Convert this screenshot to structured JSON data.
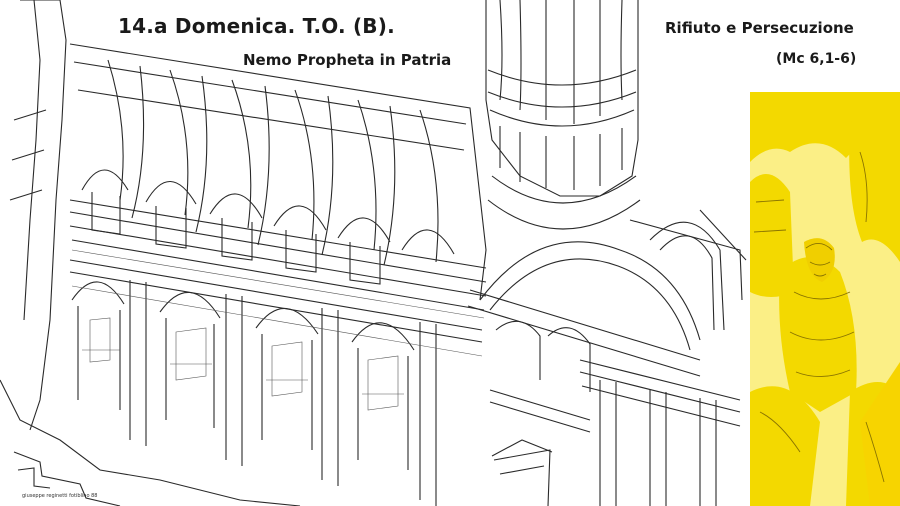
{
  "slide": {
    "title": "14.a  Domenica. T.O.  (B).",
    "subtitle": "Nemo Propheta in Patria",
    "theme": "Rifiuto e Persecuzione",
    "reference": "(Mc 6,1-6)",
    "drawing_credit": "giuseppe reginetti fotiblino 88"
  },
  "colors": {
    "background": "#ffffff",
    "ink": "#1a1a1a",
    "accent_yellow": "#f7e43c",
    "accent_yellow_light": "#fbef86"
  },
  "images": {
    "architecture": "church-interior-axonometric-drawing",
    "panel": "yellow-tinted-illustration-of-young-man-with-robed-figures"
  }
}
